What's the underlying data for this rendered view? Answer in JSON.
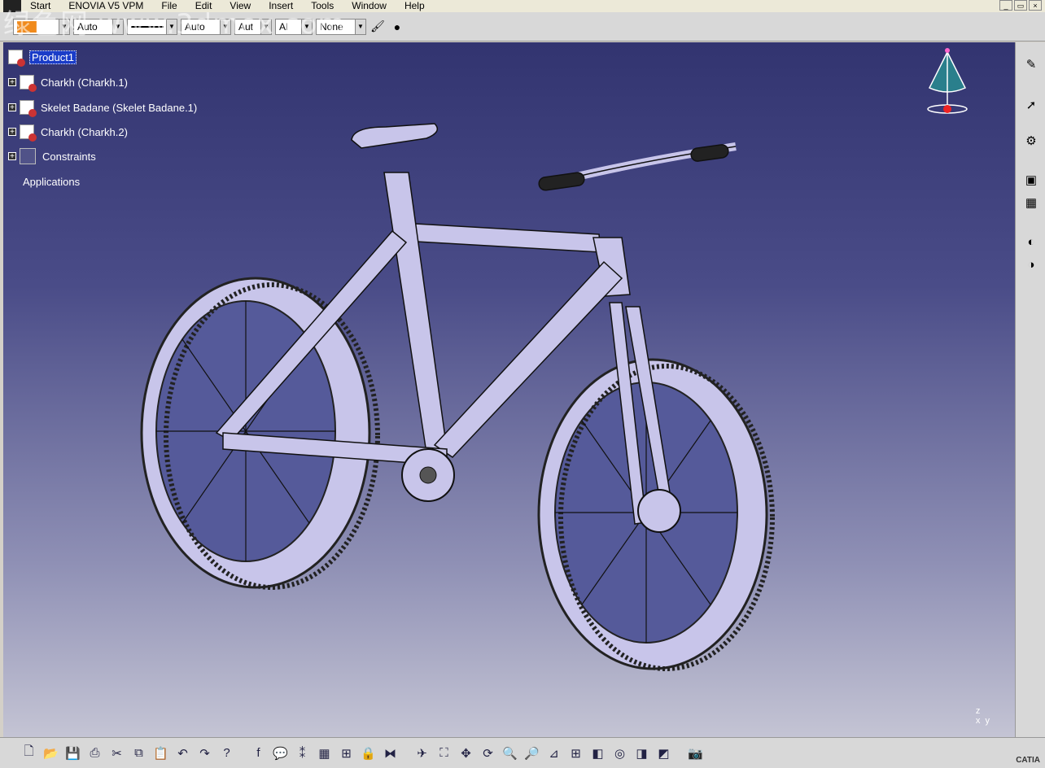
{
  "watermark": "绿色网 www.3dmox.com",
  "menubar": {
    "items": [
      "Start",
      "ENOVIA V5 VPM",
      "File",
      "Edit",
      "View",
      "Insert",
      "Tools",
      "Window",
      "Help"
    ],
    "window_buttons": [
      "_",
      "▭",
      "×"
    ]
  },
  "toolbar_top": {
    "color_value": "",
    "line_weight": "Auto",
    "line_type": "Auto",
    "layer": "Aut",
    "filter": "Al",
    "layer_none": "None",
    "colors": {
      "swatch": "#f08a1c"
    }
  },
  "spec_tree": {
    "root": "Product1",
    "children": [
      "Charkh (Charkh.1)",
      "Skelet Badane (Skelet Badane.1)",
      "Charkh (Charkh.2)",
      "Constraints"
    ],
    "applications": "Applications"
  },
  "viewport": {
    "compass_label": "compass-icon",
    "axis_label": "z\nx  y",
    "colors": {
      "bg_top": "#323470",
      "bg_bottom": "#c4c4d4"
    }
  },
  "bottom_toolbar": {
    "icons": [
      "new-icon",
      "open-icon",
      "save-icon",
      "print-icon",
      "cut-icon",
      "copy-icon",
      "paste-icon",
      "undo-icon",
      "redo-icon",
      "whats-this-icon",
      "formula-icon",
      "comment-icon",
      "knowledge-icon",
      "table-icon",
      "tree-icon",
      "lock-icon",
      "macro-icon",
      "fly-icon",
      "fit-all-icon",
      "pan-icon",
      "rotate-icon",
      "zoom-in-icon",
      "zoom-out-icon",
      "normal-view-icon",
      "multi-view-icon",
      "iso-view-icon",
      "render-style-icon",
      "hide-show-icon",
      "swap-visible-icon",
      "capture-icon"
    ]
  },
  "brand": "CATIA"
}
